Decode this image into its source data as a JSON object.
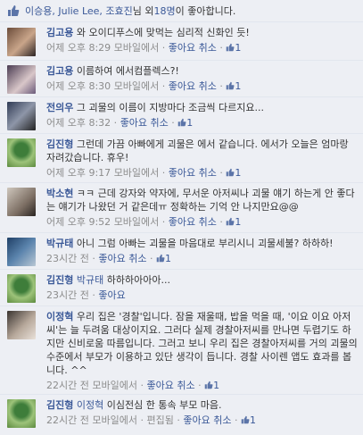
{
  "likes": {
    "names": "이승용, Julie Lee, 조효진",
    "middle": "님 외 ",
    "others": "18명",
    "suffix": "이 좋아합니다."
  },
  "comments": [
    {
      "author": "김고용",
      "text": "와 오이디푸스에 맞먹는 심리적 신화인 듯!",
      "time": "어제 오후 8:29",
      "device": "모바일에서",
      "action": "좋아요 취소",
      "likes": "1"
    },
    {
      "author": "김고용",
      "text": "이름하여 에서컴플렉스?!",
      "time": "어제 오후 8:30",
      "device": "모바일에서",
      "action": "좋아요 취소",
      "likes": "1"
    },
    {
      "author": "전의우",
      "text": "그 괴물의 이름이 지방마다 조금씩 다르지요...",
      "time": "어제 오후 8:32",
      "device": "",
      "action": "좋아요 취소",
      "likes": "1"
    },
    {
      "author": "김진형",
      "text": "그런데 가끔 아빠에게 괴물은 에서 같습니다. 에서가 오늘은 엄마랑 자려갔습니다. 휴우!",
      "time": "어제 오후 9:17",
      "device": "모바일에서",
      "action": "좋아요 취소",
      "likes": "1"
    },
    {
      "author": "박소현",
      "text": "ㅋㅋ 근데 강자와 약자에, 무서운 아저씨나 괴물 얘기 하는게 안 좋다는 얘기가 나왔던 거 같은데ㅠ 정확하는 기억 안 나지만요@@",
      "time": "어제 오후 9:52",
      "device": "모바일에서",
      "action": "좋아요 취소",
      "likes": "1"
    },
    {
      "author": "박규태",
      "text": "아니 그럼 아빠는 괴물을 마음대로 부리시니 괴물세불? 하하하!",
      "time": "23시간 전",
      "device": "",
      "action": "좋아요 취소",
      "likes": "1"
    },
    {
      "author": "김진형",
      "mention": "박규태",
      "text": " 하하하아아아...",
      "time": "23시간 전",
      "device": "",
      "action": "좋아요",
      "likes": ""
    },
    {
      "author": "이정혁",
      "text": "우리 집은 '경찰'입니다. 잠을 재울때, 밥을 먹을 때, '이요 이요 아저씨'는 늘 두려움 대상이지요. 그러다 실제 경찰아저씨를 만나면 두렵기도 하지만 신비로움 따름입니다. 그러고 보니 우리 집은 경찰아저씨를 거의 괴물의 수준에서 부모가 이용하고 있단 생각이 듭니다. 경찰 사이렌 앱도 효과를 봅니다. ^^",
      "time": "22시간 전",
      "device": "모바일에서",
      "action": "좋아요 취소",
      "likes": "1"
    },
    {
      "author": "김진형",
      "mention": "이정혁",
      "text": " 이심전심 한 통속 부모 마음.",
      "time": "22시간 전",
      "device": "모바일에서",
      "action": "편집됨",
      "likes": "1",
      "extra_action": "좋아요 취소"
    }
  ],
  "colors": {
    "link": "#3b5998",
    "bg": "#edeff4",
    "meta": "#8c8c8c"
  }
}
